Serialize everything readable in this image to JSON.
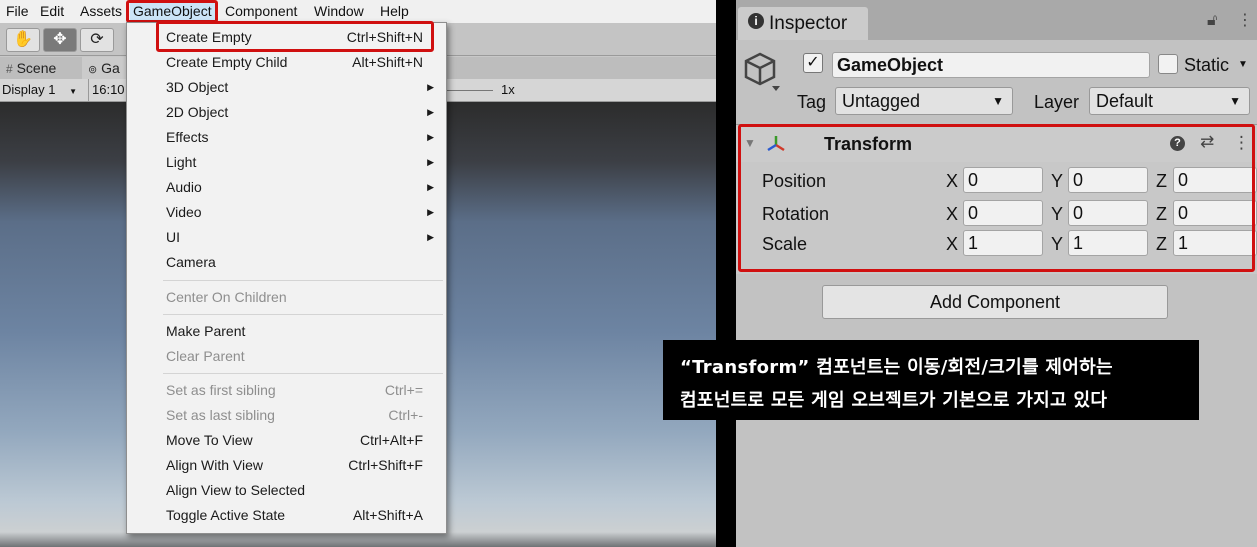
{
  "menubar": {
    "items": [
      "File",
      "Edit",
      "Assets",
      "GameObject",
      "Component",
      "Window",
      "Help"
    ]
  },
  "toolbar": {
    "tools": [
      "hand-icon",
      "move-icon",
      "rotate-icon"
    ]
  },
  "view_tabs": {
    "scene": "Scene",
    "game": "Ga"
  },
  "game_bar": {
    "display": "Display 1",
    "aspect": "16:10",
    "scale": "1x"
  },
  "gameobject_menu": {
    "items": [
      {
        "label": "Create Empty",
        "shortcut": "Ctrl+Shift+N"
      },
      {
        "label": "Create Empty Child",
        "shortcut": "Alt+Shift+N"
      },
      {
        "label": "3D Object",
        "shortcut": ""
      },
      {
        "label": "2D Object",
        "shortcut": ""
      },
      {
        "label": "Effects",
        "shortcut": ""
      },
      {
        "label": "Light",
        "shortcut": ""
      },
      {
        "label": "Audio",
        "shortcut": ""
      },
      {
        "label": "Video",
        "shortcut": ""
      },
      {
        "label": "UI",
        "shortcut": ""
      },
      {
        "label": "Camera",
        "shortcut": ""
      },
      {
        "label": "Center On Children",
        "shortcut": ""
      },
      {
        "label": "Make Parent",
        "shortcut": ""
      },
      {
        "label": "Clear Parent",
        "shortcut": ""
      },
      {
        "label": "Set as first sibling",
        "shortcut": "Ctrl+="
      },
      {
        "label": "Set as last sibling",
        "shortcut": "Ctrl+-"
      },
      {
        "label": "Move To View",
        "shortcut": "Ctrl+Alt+F"
      },
      {
        "label": "Align With View",
        "shortcut": "Ctrl+Shift+F"
      },
      {
        "label": "Align View to Selected",
        "shortcut": ""
      },
      {
        "label": "Toggle Active State",
        "shortcut": "Alt+Shift+A"
      }
    ]
  },
  "inspector": {
    "tab_label": "Inspector",
    "object_name": "GameObject",
    "static_label": "Static",
    "tag_label": "Tag",
    "tag_value": "Untagged",
    "layer_label": "Layer",
    "layer_value": "Default",
    "component_title": "Transform",
    "rows": [
      {
        "label": "Position",
        "x": "0",
        "y": "0",
        "z": "0"
      },
      {
        "label": "Rotation",
        "x": "0",
        "y": "0",
        "z": "0"
      },
      {
        "label": "Scale",
        "x": "1",
        "y": "1",
        "z": "1"
      }
    ],
    "axis_x": "X",
    "axis_y": "Y",
    "axis_z": "Z",
    "add_component": "Add Component"
  },
  "caption": {
    "line1": "“Transform” 컴포넌트는 이동/회전/크기를 제어하는",
    "line2": "컴포넌트로 모든 게임 오브젝트가 기본으로 가지고 있다"
  },
  "colors": {
    "highlight_red": "#d01010",
    "menu_hover": "#cce4f7"
  }
}
